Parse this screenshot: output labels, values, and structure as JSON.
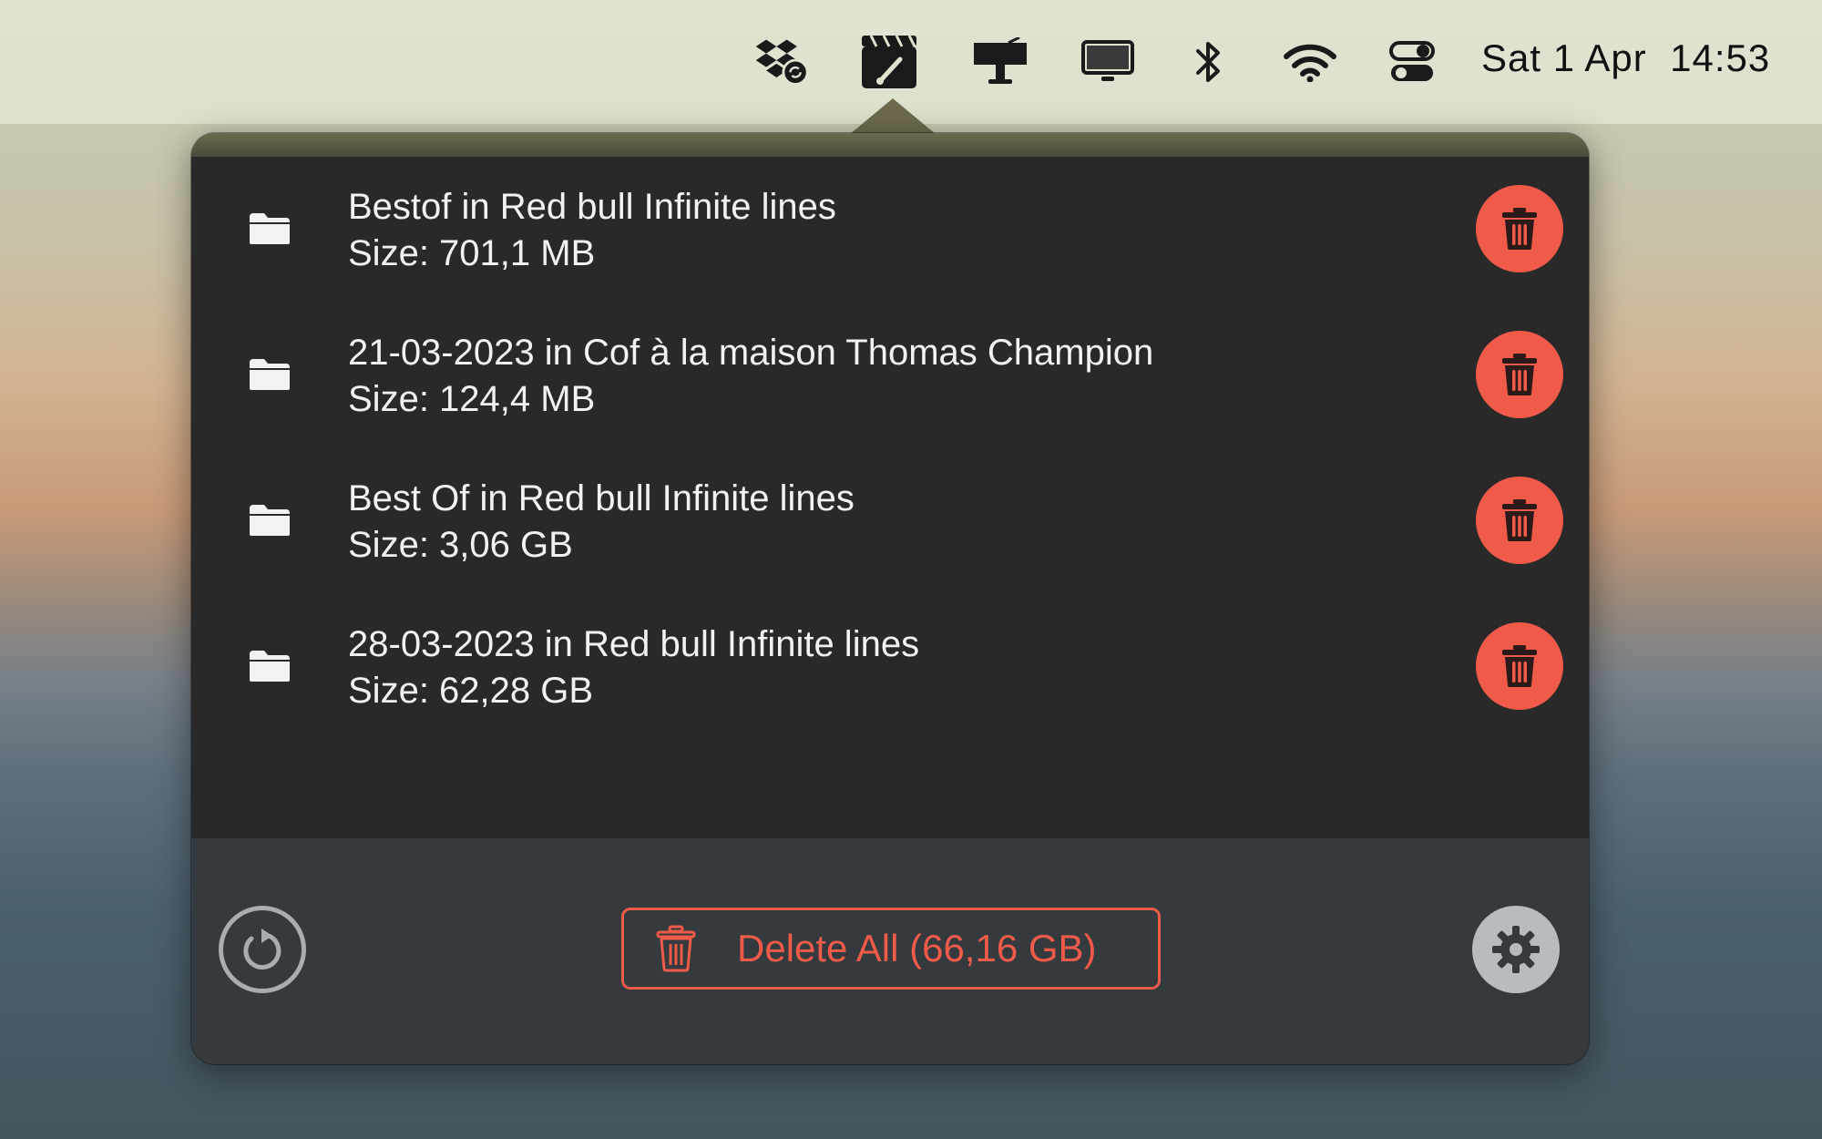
{
  "menubar": {
    "icons": [
      "dropbox-sync-icon",
      "clapperboard-app-icon",
      "display-stand-icon",
      "monitor-icon",
      "bluetooth-icon",
      "wifi-icon",
      "control-center-icon"
    ],
    "date": "Sat 1 Apr",
    "time": "14:53"
  },
  "items": [
    {
      "title": "Bestof in Red bull Infinite lines",
      "size": "Size: 701,1 MB"
    },
    {
      "title": "21-03-2023 in Cof à la maison Thomas Champion",
      "size": "Size: 124,4 MB"
    },
    {
      "title": "Best Of in Red bull Infinite lines",
      "size": "Size: 3,06 GB"
    },
    {
      "title": "28-03-2023 in Red bull Infinite lines",
      "size": "Size: 62,28 GB"
    }
  ],
  "footer": {
    "delete_all_label": "Delete All (66,16 GB)"
  },
  "colors": {
    "accent_red": "#ef5b48",
    "popover_bg": "#292929",
    "footer_bg": "#343a3e"
  }
}
